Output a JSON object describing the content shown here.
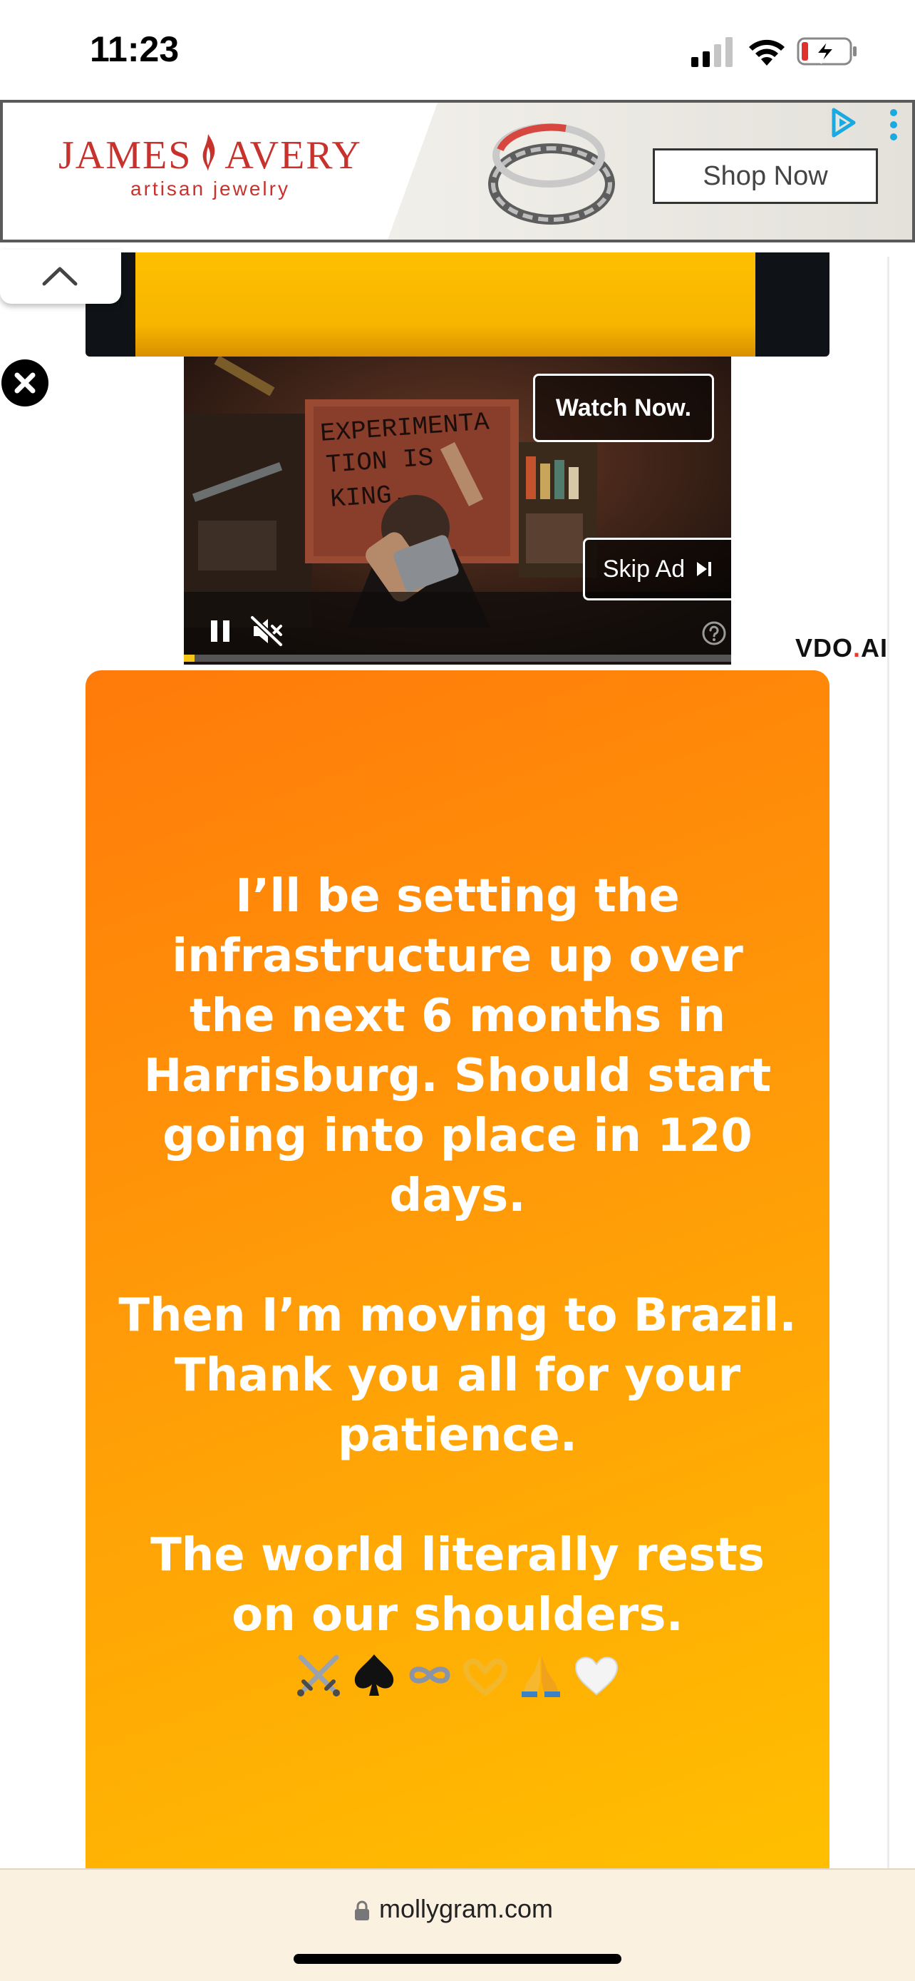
{
  "status_bar": {
    "time": "11:23",
    "signal_icon": "cellular-signal-icon",
    "wifi_icon": "wifi-icon",
    "battery_icon": "battery-charging-icon",
    "battery_color": "#e0322c"
  },
  "top_ad": {
    "brand_name_left": "JAMES",
    "brand_name_right": "AVERY",
    "brand_tagline": "artisan jewelry",
    "brand_color": "#c8322d",
    "cta_label": "Shop Now",
    "adchoices_icon": "adchoices-icon",
    "menu_icon": "vertical-dots-icon"
  },
  "video_ad": {
    "scene_sign_lines": [
      "EXPERIMENTA",
      "TION IS",
      "KING."
    ],
    "watch_now_label": "Watch Now.",
    "skip_ad_label": "Skip Ad",
    "progress": 0.02,
    "provider": "VDO.AI",
    "provider_name": "VDO",
    "provider_dot": ".",
    "provider_suffix": "AI",
    "accent_color": "#f5c518"
  },
  "story": {
    "paragraph_1": "I’ll be setting the\ninfrastructure up over\nthe next 6 months in\nHarrisburg. Should start\ngoing into place in 120\ndays.",
    "paragraph_2": "Then I’m moving to Brazil.\nThank you all for your\npatience.",
    "paragraph_3": "The world literally rests\non our shoulders.",
    "emojis": [
      "crossed-swords-icon",
      "spade-suit-icon",
      "infinity-icon",
      "heart-hands-icon",
      "folded-hands-icon",
      "white-heart-icon"
    ],
    "gradient_start": "#ff7a0a",
    "gradient_end": "#ffc000"
  },
  "browser": {
    "url": "mollygram.com"
  }
}
